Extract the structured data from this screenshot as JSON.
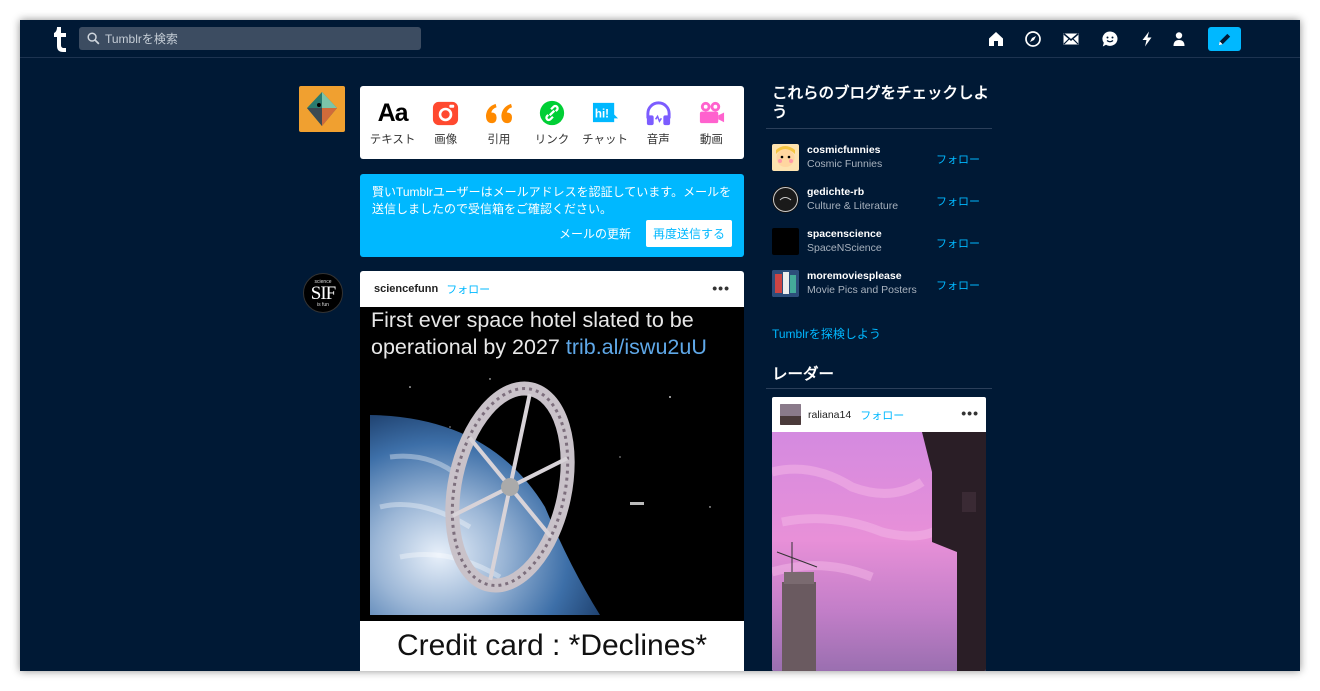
{
  "header": {
    "logo": "tumblr-logo",
    "search_placeholder": "Tumblrを検索",
    "nav_icons": [
      "home-icon",
      "explore-icon",
      "inbox-icon",
      "messaging-icon",
      "activity-icon",
      "account-icon",
      "compose-icon"
    ],
    "accent_color": "#00b8ff",
    "background_color": "#001935"
  },
  "composer": {
    "types": [
      {
        "label": "テキスト",
        "icon": "text-icon",
        "glyph": "Aa",
        "color": "#000000"
      },
      {
        "label": "画像",
        "icon": "camera-icon",
        "color": "#ff492f"
      },
      {
        "label": "引用",
        "icon": "quote-icon",
        "color": "#ff8a00"
      },
      {
        "label": "リンク",
        "icon": "link-icon",
        "color": "#00cf35"
      },
      {
        "label": "チャット",
        "icon": "chat-icon",
        "glyph": "hi!",
        "color": "#00b8ff"
      },
      {
        "label": "音声",
        "icon": "headphones-icon",
        "color": "#7c5cff"
      },
      {
        "label": "動画",
        "icon": "video-icon",
        "color": "#ff62ce"
      }
    ]
  },
  "verify_banner": {
    "message": "賢いTumblrユーザーはメールアドレスを認証しています。メールを送信しましたので受信箱をご確認ください。",
    "update_email_link": "メールの更新",
    "resend_button": "再度送信する"
  },
  "post": {
    "avatar_text_top": "science",
    "avatar_text": "SIF",
    "avatar_text_bottom": "is fun",
    "username": "sciencefunn",
    "follow_label": "フォロー",
    "more": "•••",
    "caption_line1": "First ever space hotel slated to be",
    "caption_line2_prefix": "operational by 2027 ",
    "caption_link": "trib.al/iswu2uU",
    "meme_text": "Credit card : *Declines*"
  },
  "sidebar": {
    "recommend_title": "これらのブログをチェックしよう",
    "recommendations": [
      {
        "name": "cosmicfunnies",
        "title": "Cosmic Funnies",
        "follow": "フォロー"
      },
      {
        "name": "gedichte-rb",
        "title": "Culture & Literature",
        "follow": "フォロー"
      },
      {
        "name": "spacenscience",
        "title": "SpaceNScience",
        "follow": "フォロー"
      },
      {
        "name": "moremoviesplease",
        "title": "Movie Pics and Posters",
        "follow": "フォロー"
      }
    ],
    "explore_link": "Tumblrを探検しよう",
    "radar_title": "レーダー",
    "radar": {
      "username": "raliana14",
      "follow": "フォロー",
      "more": "•••"
    }
  }
}
